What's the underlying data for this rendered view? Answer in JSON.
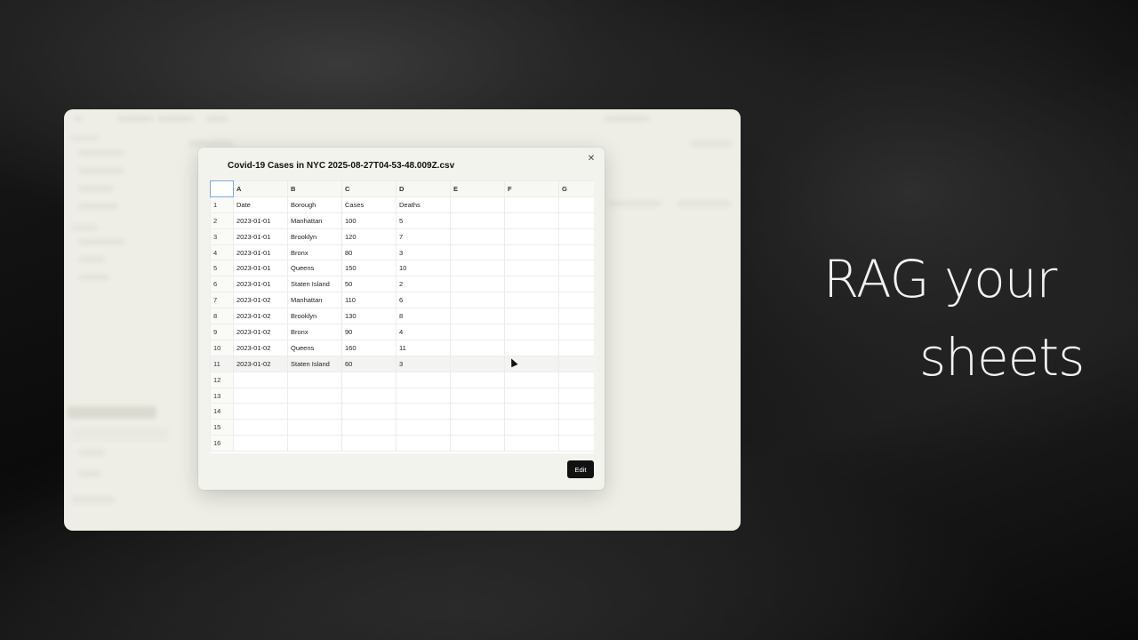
{
  "modal": {
    "title": "Covid-19 Cases in NYC 2025-08-27T04-53-48.009Z.csv",
    "edit_label": "Edit",
    "close_icon": "close-icon"
  },
  "sheet": {
    "columns": [
      "A",
      "B",
      "C",
      "D",
      "E",
      "F",
      "G"
    ],
    "rows": [
      {
        "num": "1",
        "cells": [
          "Date",
          "Borough",
          "Cases",
          "Deaths",
          "",
          "",
          ""
        ]
      },
      {
        "num": "2",
        "cells": [
          "2023-01-01",
          "Manhattan",
          "100",
          "5",
          "",
          "",
          ""
        ]
      },
      {
        "num": "3",
        "cells": [
          "2023-01-01",
          "Brooklyn",
          "120",
          "7",
          "",
          "",
          ""
        ]
      },
      {
        "num": "4",
        "cells": [
          "2023-01-01",
          "Bronx",
          "80",
          "3",
          "",
          "",
          ""
        ]
      },
      {
        "num": "5",
        "cells": [
          "2023-01-01",
          "Queens",
          "150",
          "10",
          "",
          "",
          ""
        ]
      },
      {
        "num": "6",
        "cells": [
          "2023-01-01",
          "Staten Island",
          "50",
          "2",
          "",
          "",
          ""
        ]
      },
      {
        "num": "7",
        "cells": [
          "2023-01-02",
          "Manhattan",
          "110",
          "6",
          "",
          "",
          ""
        ]
      },
      {
        "num": "8",
        "cells": [
          "2023-01-02",
          "Brooklyn",
          "130",
          "8",
          "",
          "",
          ""
        ]
      },
      {
        "num": "9",
        "cells": [
          "2023-01-02",
          "Bronx",
          "90",
          "4",
          "",
          "",
          ""
        ]
      },
      {
        "num": "10",
        "cells": [
          "2023-01-02",
          "Queens",
          "160",
          "11",
          "",
          "",
          ""
        ]
      },
      {
        "num": "11",
        "cells": [
          "2023-01-02",
          "Staten Island",
          "60",
          "3",
          "",
          "",
          ""
        ]
      },
      {
        "num": "12",
        "cells": [
          "",
          "",
          "",
          "",
          "",
          "",
          ""
        ]
      },
      {
        "num": "13",
        "cells": [
          "",
          "",
          "",
          "",
          "",
          "",
          ""
        ]
      },
      {
        "num": "14",
        "cells": [
          "",
          "",
          "",
          "",
          "",
          "",
          ""
        ]
      },
      {
        "num": "15",
        "cells": [
          "",
          "",
          "",
          "",
          "",
          "",
          ""
        ]
      },
      {
        "num": "16",
        "cells": [
          "",
          "",
          "",
          "",
          "",
          "",
          ""
        ]
      }
    ]
  },
  "hero": {
    "line1": "RAG your",
    "line2": "sheets"
  }
}
